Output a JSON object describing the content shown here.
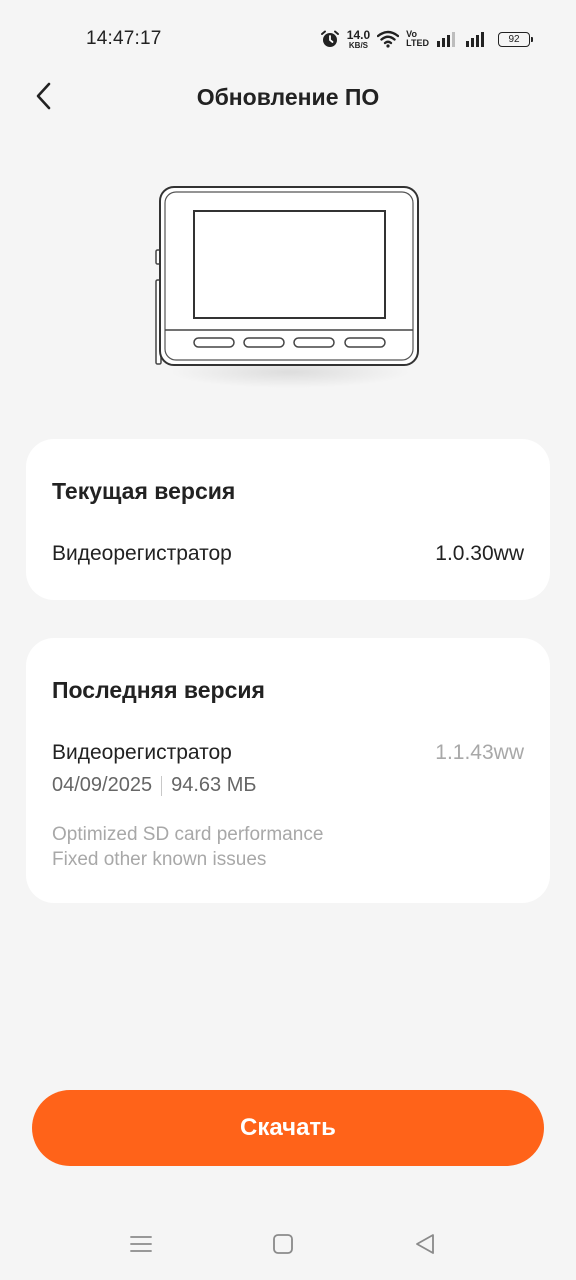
{
  "status_bar": {
    "time": "14:47:17",
    "net_speed_value": "14.0",
    "net_speed_unit": "KB/S",
    "volte_top": "Vo",
    "volte_bottom": "LTED",
    "battery": "92"
  },
  "header": {
    "title": "Обновление ПО"
  },
  "current_version": {
    "title": "Текущая версия",
    "device_label": "Видеорегистратор",
    "version": "1.0.30ww"
  },
  "latest_version": {
    "title": "Последняя версия",
    "device_label": "Видеорегистратор",
    "version": "1.1.43ww",
    "date": "04/09/2025",
    "size": "94.63 МБ",
    "notes": [
      "Optimized SD card performance",
      "Fixed other known issues"
    ]
  },
  "download_button": {
    "label": "Скачать"
  },
  "colors": {
    "accent": "#ff6319",
    "background": "#f5f5f5",
    "card": "#ffffff",
    "muted_text": "#a8a8a8"
  },
  "icons": {
    "back": "chevron-left-icon",
    "alarm": "alarm-clock-icon",
    "wifi": "wifi-icon",
    "signal": "signal-bars-icon",
    "nav_menu": "menu-icon",
    "nav_home": "home-square-icon",
    "nav_back": "back-triangle-icon"
  }
}
